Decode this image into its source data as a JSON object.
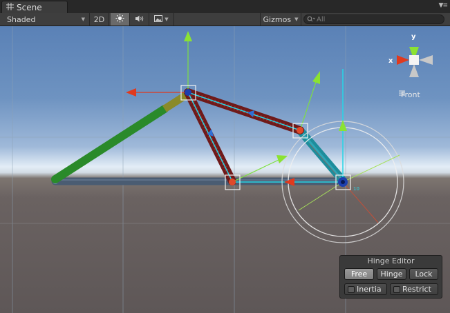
{
  "tab": {
    "title": "Scene",
    "icon": "scene-grid-icon"
  },
  "toolbar": {
    "shading_mode": "Shaded",
    "mode_2d": "2D",
    "gizmos_label": "Gizmos",
    "search_placeholder": "All",
    "icons": [
      "sun-lighting-icon",
      "audio-speaker-icon",
      "image-effects-icon"
    ]
  },
  "orientation_gizmo": {
    "axis_x": "x",
    "axis_y": "y",
    "view_label": "Front"
  },
  "handle": {
    "degree_label": "10"
  },
  "hinge_editor": {
    "title": "Hinge Editor",
    "modes": [
      {
        "label": "Free",
        "active": true
      },
      {
        "label": "Hinge",
        "active": false
      },
      {
        "label": "Lock",
        "active": false
      }
    ],
    "options": [
      {
        "label": "Inertia",
        "checked": false
      },
      {
        "label": "Restrict",
        "checked": false
      }
    ]
  },
  "colors": {
    "x_axis": "#e03a1e",
    "y_axis": "#8be232",
    "z_axis": "#2f6fd6",
    "link_red": "#7a1c1c",
    "link_green": "#2a8a2a",
    "link_teal": "#23a5b5"
  }
}
